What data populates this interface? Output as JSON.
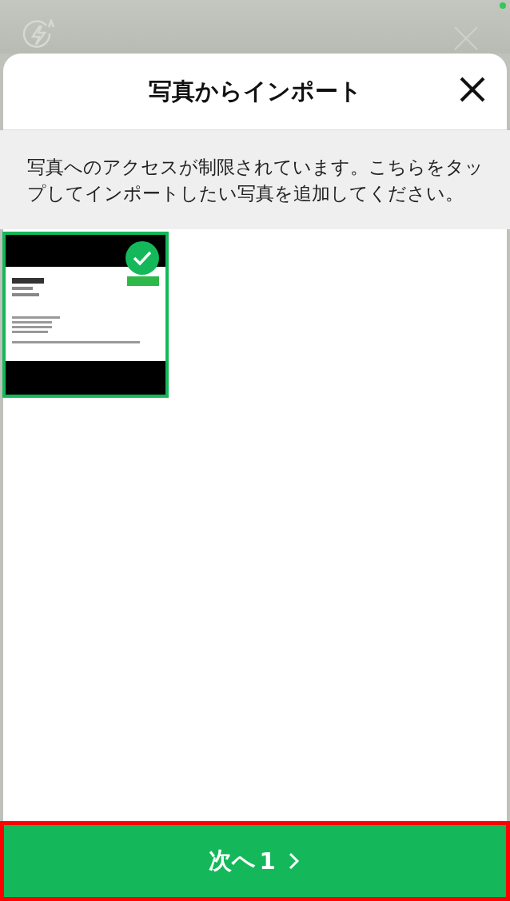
{
  "sheet": {
    "title": "写真からインポート"
  },
  "notice": "写真へのアクセスが制限されています。こちらをタップしてインポートしたい写真を追加してください。",
  "photos": [
    {
      "kind": "picture",
      "selected": true
    }
  ],
  "next_button": {
    "label": "次へ",
    "count": "1"
  }
}
